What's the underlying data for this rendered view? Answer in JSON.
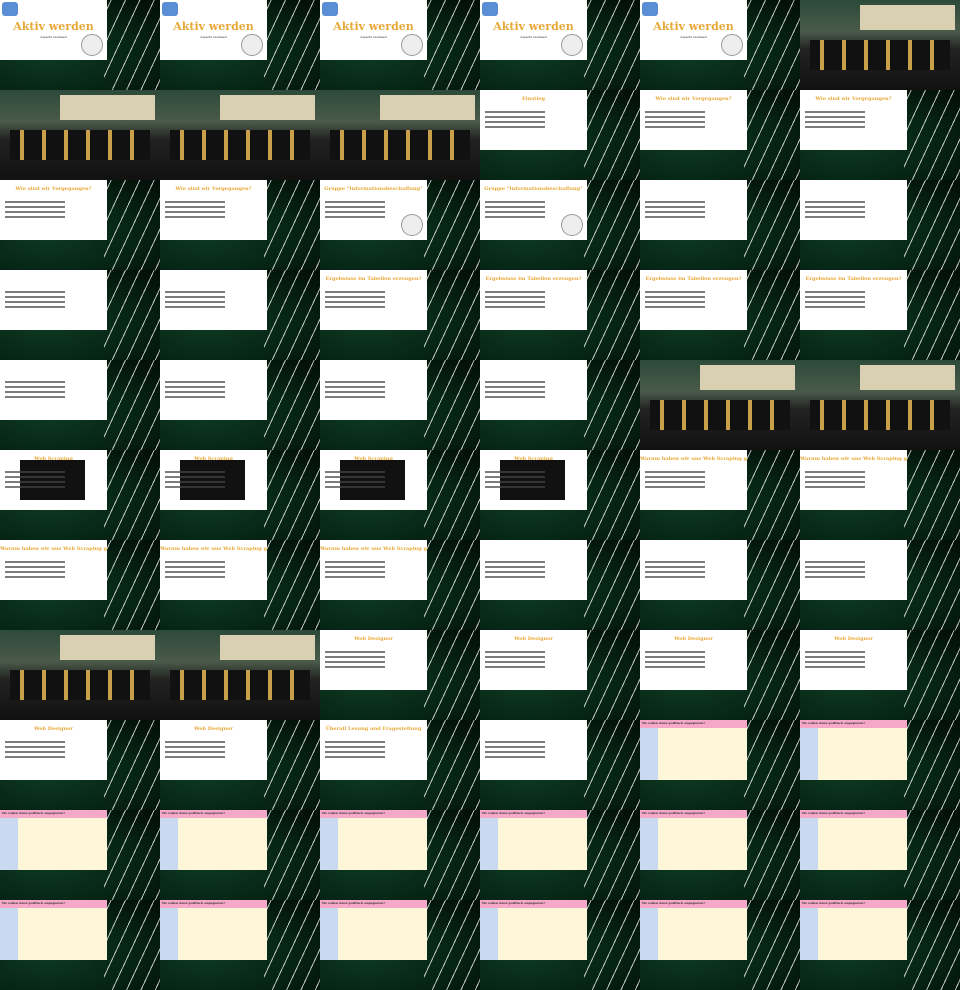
{
  "page": {
    "background": "#000000",
    "accent": "#e8a838"
  },
  "slides": {
    "aktiv_title": "Aktiv werden",
    "aktiv_sub": "Aspects reviewed",
    "einstieg": "Einstieg",
    "vorgegangen": "Wie sind wir Vorgegangen?",
    "gruppe_info": "Gruppe \"Informationsbeschaffung\"",
    "web_scraping": "Web Scraping",
    "warum_web_scraping": "Warum haben wir uns Web Scraping gefunden?",
    "ergebnisse": "Ergebnisse im Tabellen erzeugen?",
    "web_designer": "Web Designer",
    "ueberall_lesen": "Überall Lesung und Fragestellung",
    "wo_sollen": "Wo sollen denn politisch engagieren?"
  },
  "thumbnails": [
    "aktiv",
    "aktiv",
    "aktiv",
    "aktiv",
    "aktiv",
    "photo",
    "photo",
    "photo",
    "photo",
    "einstieg",
    "vorgegangen",
    "vorgegangen",
    "vorgegangen",
    "vorgegangen",
    "gruppe",
    "gruppe",
    "map",
    "map",
    "map",
    "map",
    "ergebnisse",
    "ergebnisse",
    "ergebnisse",
    "ergebnisse",
    "shotwhite",
    "shotwhite",
    "shotwhite",
    "shotwhite",
    "photo",
    "photo",
    "dark",
    "dark",
    "table",
    "table",
    "warum",
    "warum",
    "warum",
    "warum",
    "warum",
    "venn",
    "venn",
    "venn",
    "photo",
    "photo",
    "designer",
    "designer",
    "designer",
    "designer",
    "designer",
    "designer",
    "ueberall",
    "blank",
    "wo",
    "wo",
    "wo",
    "wo",
    "wo",
    "wo",
    "wo",
    "wo",
    "shot",
    "shot",
    "shot",
    "shot",
    "shot",
    "map2"
  ]
}
